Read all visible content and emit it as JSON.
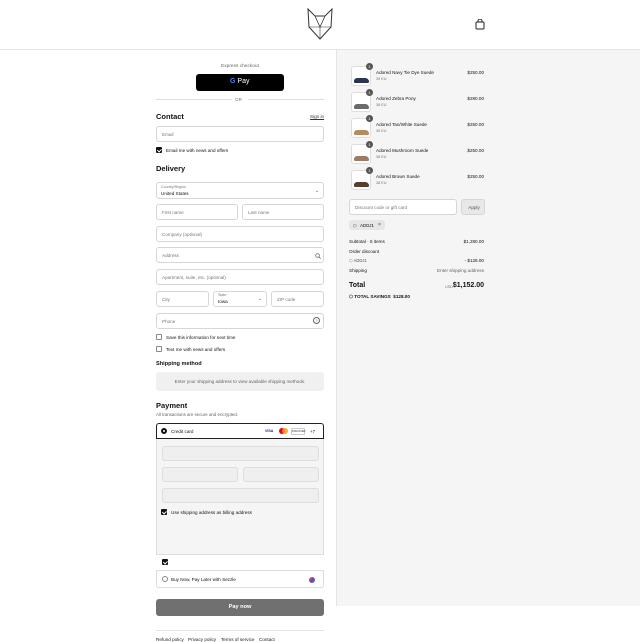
{
  "header": {
    "logo_icon": "fox-logo-icon",
    "cart_icon": "shopping-bag-icon"
  },
  "express": {
    "label": "Express checkout",
    "gpay_label": "Pay",
    "or_label": "OR"
  },
  "contact": {
    "heading": "Contact",
    "sign_in": "Sign in",
    "email_placeholder": "Email",
    "news_label": "Email me with news and offers"
  },
  "delivery": {
    "heading": "Delivery",
    "country_label": "Country/Region",
    "country_value": "United States",
    "first_name": "First name",
    "last_name": "Last name",
    "company": "Company (optional)",
    "address": "Address",
    "apartment": "Apartment, suite, etc. (optional)",
    "city": "City",
    "state_label": "State",
    "state_value": "Iowa",
    "zip": "ZIP code",
    "phone": "Phone",
    "save_info": "Save this information for next time",
    "text_me": "Text me with news and offers"
  },
  "shipping": {
    "heading": "Shipping method",
    "message": "Enter your shipping address to view available shipping methods."
  },
  "payment": {
    "heading": "Payment",
    "subtitle": "All transactions are secure and encrypted.",
    "credit_card": "Credit card",
    "more_cards": "+7",
    "card_brands": [
      "VISA",
      "MC",
      "DISCOVER"
    ],
    "billing_label": "Use shipping address as billing address",
    "sezzle_label": "Buy Now, Pay Later with Sezzle",
    "pay_now": "Pay now"
  },
  "footer": {
    "links": [
      "Refund policy",
      "Privacy policy",
      "Terms of service",
      "Contact"
    ]
  },
  "cart": {
    "items": [
      {
        "name": "Adored Navy Tie Dye Suede",
        "variant": "39 EU",
        "price": "$250.00",
        "qty": "1",
        "color": "#2c3550"
      },
      {
        "name": "Adored Zebra Pony",
        "variant": "38 EU",
        "price": "$280.00",
        "qty": "1",
        "color": "#6b6b6b"
      },
      {
        "name": "Adored Tan/White Suede",
        "variant": "39 EU",
        "price": "$250.00",
        "qty": "1",
        "color": "#b98a5e"
      },
      {
        "name": "Adored Mushroom Suede",
        "variant": "38 EU",
        "price": "$250.00",
        "qty": "1",
        "color": "#9c7b67"
      },
      {
        "name": "Adored Brown Suede",
        "variant": "38 EU",
        "price": "$250.00",
        "qty": "1",
        "color": "#5a3d2b"
      }
    ],
    "discount_placeholder": "Discount code or gift card",
    "apply": "Apply",
    "code_tag": "ADDJ1",
    "subtotal_label": "Subtotal · 5 items",
    "subtotal_value": "$1,280.00",
    "order_discount_label": "Order discount",
    "discount_code": "ADDJ1",
    "discount_value": "- $128.00",
    "shipping_label": "Shipping",
    "shipping_value": "Enter shipping address",
    "total_label": "Total",
    "currency": "USD",
    "total_value": "$1,152.00",
    "savings_label": "TOTAL SAVINGS",
    "savings_value": "$128.00"
  }
}
